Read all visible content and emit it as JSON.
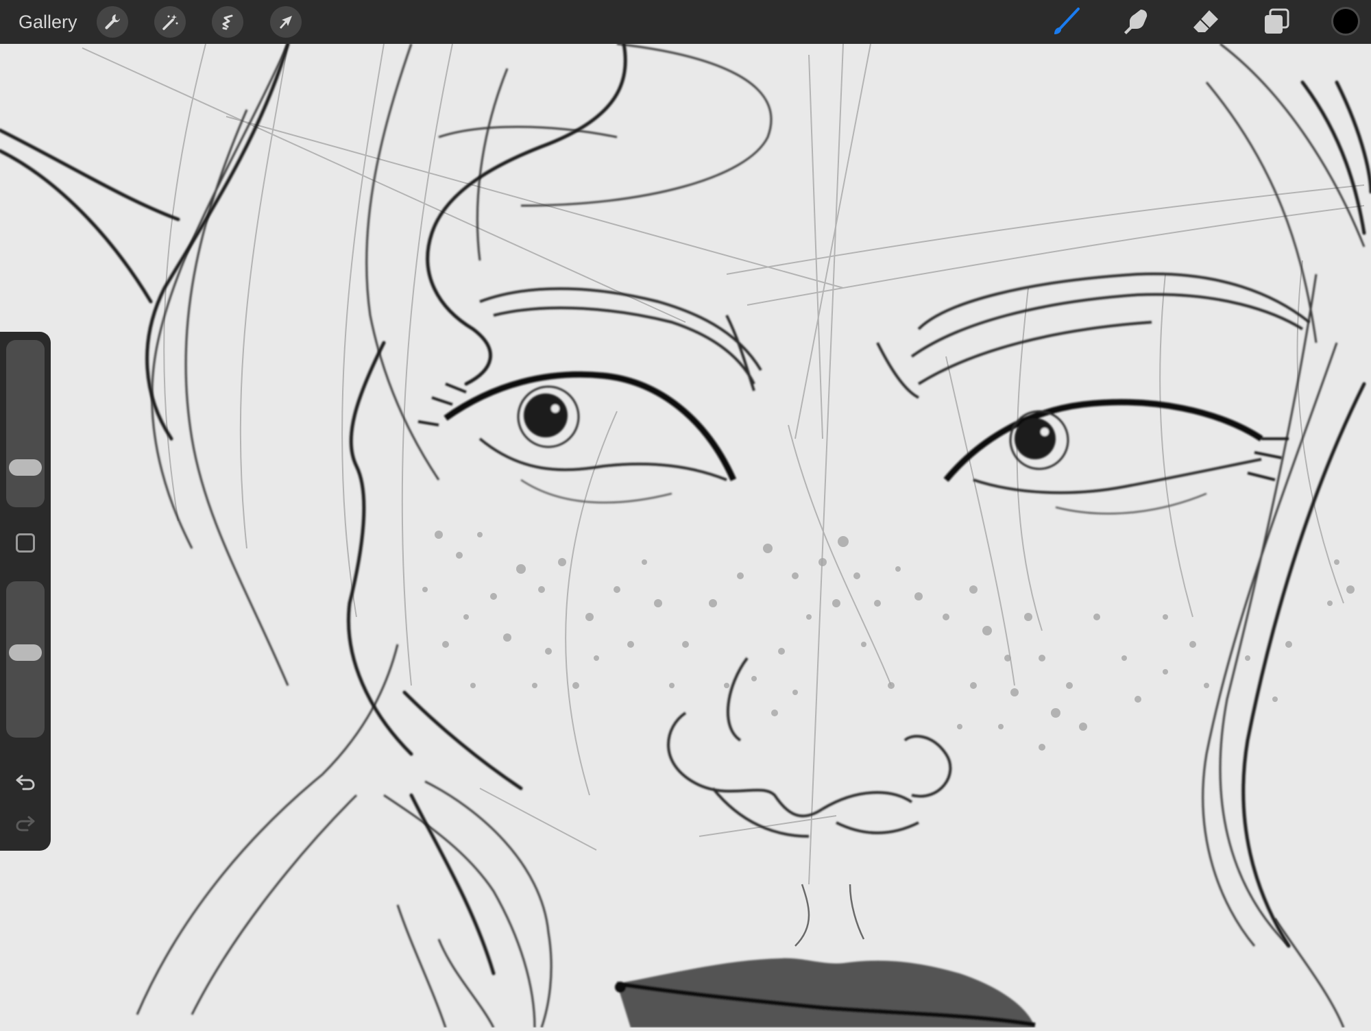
{
  "toolbar": {
    "gallery_label": "Gallery",
    "left_tools": [
      {
        "name": "actions",
        "icon": "wrench-icon"
      },
      {
        "name": "adjustments",
        "icon": "magic-wand-icon"
      },
      {
        "name": "selection",
        "icon": "selection-s-icon"
      },
      {
        "name": "transform",
        "icon": "arrow-cursor-icon"
      }
    ],
    "right_tools": [
      {
        "name": "brush",
        "icon": "brush-icon",
        "active": true
      },
      {
        "name": "smudge",
        "icon": "smudge-finger-icon",
        "active": false
      },
      {
        "name": "eraser",
        "icon": "eraser-icon",
        "active": false
      },
      {
        "name": "layers",
        "icon": "layers-icon",
        "active": false
      }
    ],
    "current_color": "#000000"
  },
  "colors": {
    "toolbar_bg": "#2b2b2b",
    "active_accent": "#1a7cf0",
    "canvas_bg": "#e9e9e9"
  },
  "sidebar": {
    "brush_size_level": 0.2,
    "opacity_level": 0.55,
    "modifier_icon": "square-icon",
    "undo_icon": "undo-icon",
    "redo_icon": "redo-icon"
  }
}
